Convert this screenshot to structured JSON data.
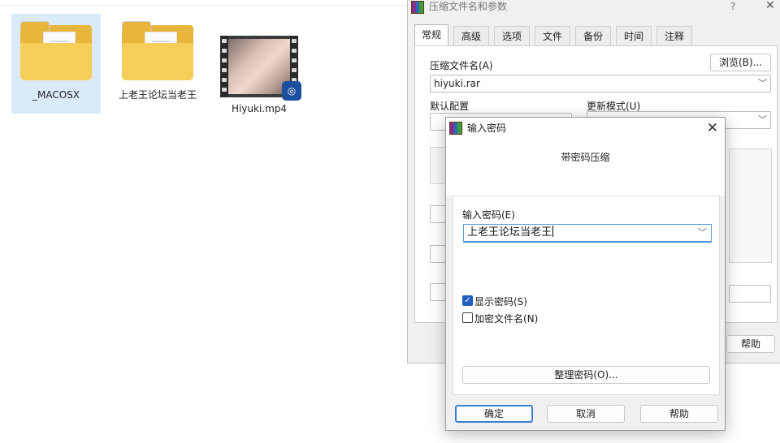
{
  "desktop": {
    "files": [
      {
        "name": "_MACOSX",
        "type": "folder",
        "selected": true
      },
      {
        "name": "上老王论坛当老王",
        "type": "folder",
        "selected": false
      },
      {
        "name": "Hiyuki.mp4",
        "type": "video",
        "selected": false
      }
    ]
  },
  "archive_dialog": {
    "title": "压缩文件名和参数",
    "help_glyph": "?",
    "close_glyph": "✕",
    "tabs": [
      "常规",
      "高级",
      "选项",
      "文件",
      "备份",
      "时间",
      "注释"
    ],
    "archive_name_label": "压缩文件名(A)",
    "browse_button": "浏览(B)...",
    "archive_name_value": "hiyuki.rar",
    "default_profile_label": "默认配置",
    "update_mode_label": "更新模式(U)",
    "help_button": "帮助"
  },
  "password_dialog": {
    "title": "输入密码",
    "close_glyph": "✕",
    "header": "带密码压缩",
    "password_label": "输入密码(E)",
    "password_value": "上老王论坛当老王",
    "show_password_label": "显示密码(S)",
    "show_password_checked": true,
    "encrypt_names_label": "加密文件名(N)",
    "encrypt_names_checked": false,
    "organize_button": "整理密码(O)...",
    "ok_button": "确定",
    "cancel_button": "取消",
    "help_button": "帮助"
  },
  "icons": {
    "folder": "folder-icon",
    "video": "video-file-icon",
    "app": "winrar-icon",
    "combo_arrow": "chevron-down-icon",
    "check": "checkmark-icon"
  }
}
